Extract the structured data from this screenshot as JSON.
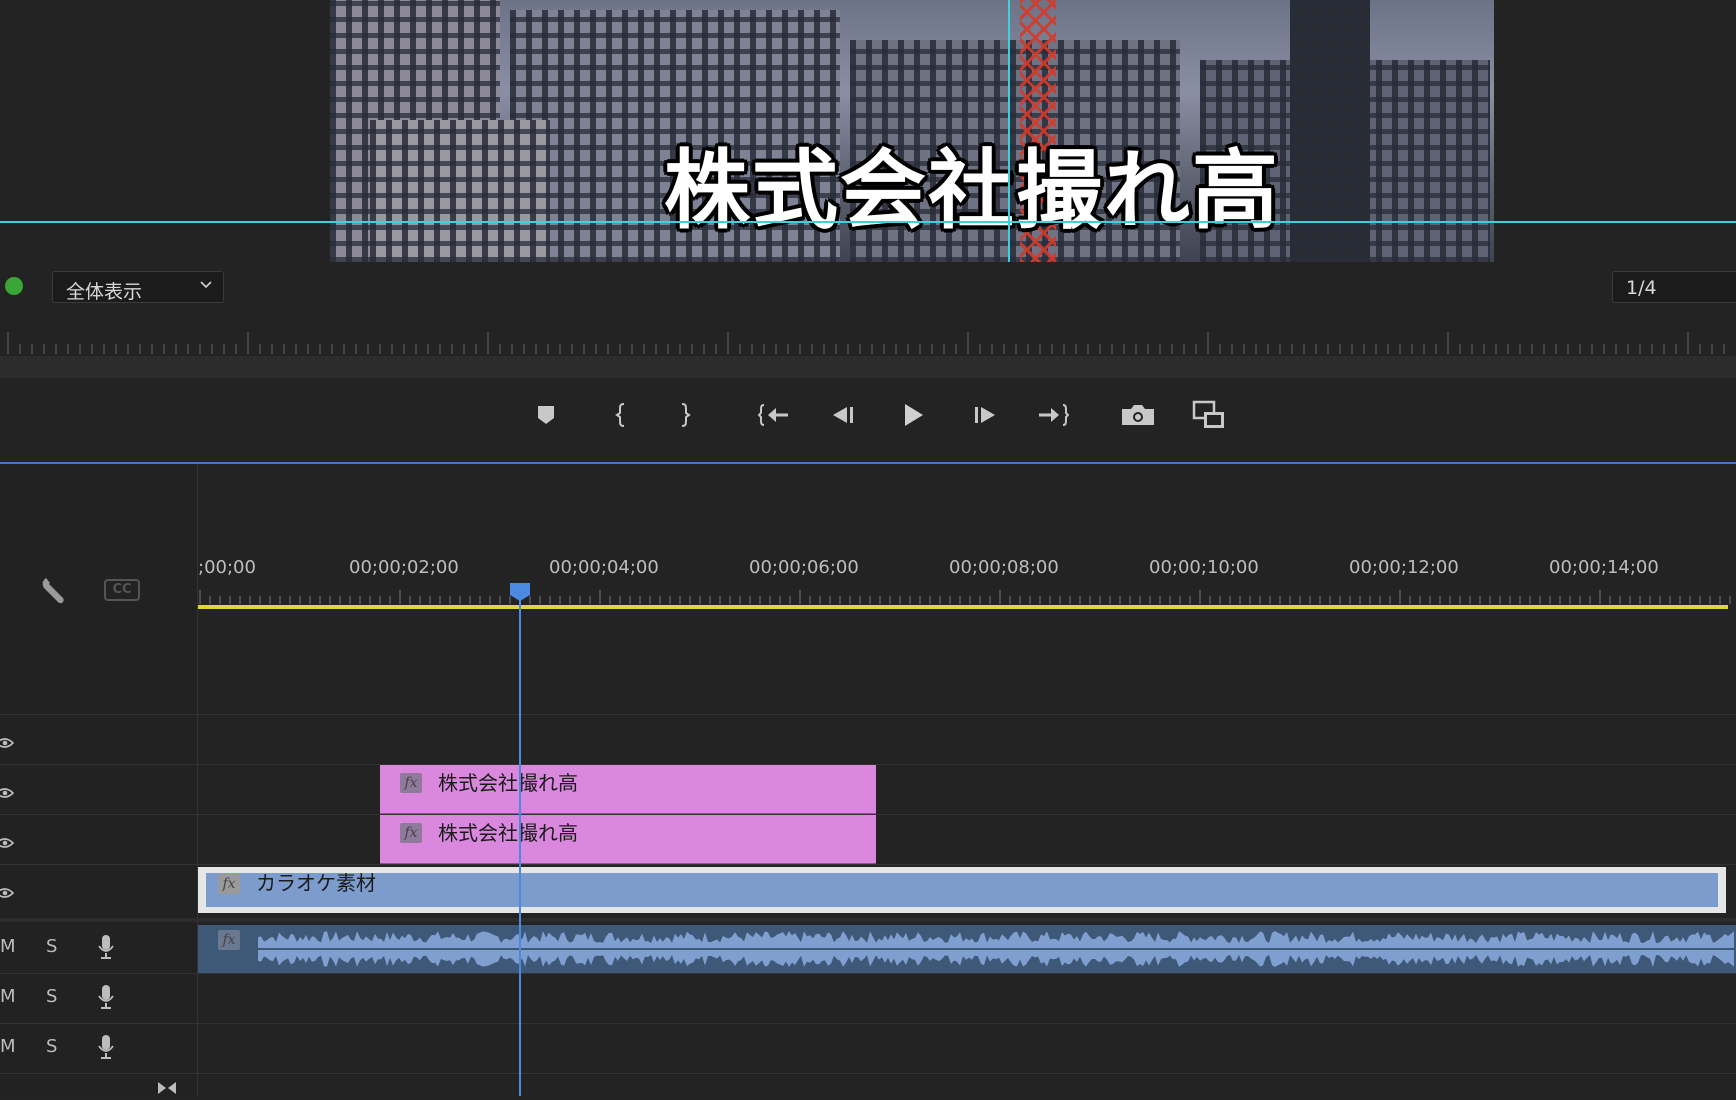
{
  "monitor": {
    "video_caption": "株式会社撮れ高",
    "fit_dropdown": "全体表示",
    "resolution": "1/4"
  },
  "transport": {
    "buttons": [
      {
        "name": "add-marker",
        "icon": "marker-icon"
      },
      {
        "name": "mark-in",
        "icon": "mark-in-icon"
      },
      {
        "name": "mark-out",
        "icon": "mark-out-icon"
      },
      {
        "name": "go-to-in",
        "icon": "go-to-in-icon"
      },
      {
        "name": "step-back",
        "icon": "step-back-icon"
      },
      {
        "name": "play",
        "icon": "play-icon"
      },
      {
        "name": "step-forward",
        "icon": "step-forward-icon"
      },
      {
        "name": "go-to-out",
        "icon": "go-to-out-icon"
      },
      {
        "name": "export-frame",
        "icon": "camera-icon"
      },
      {
        "name": "comparison-view",
        "icon": "compare-icon"
      }
    ]
  },
  "timeline": {
    "timecodes": [
      ";00;00",
      "00;00;02;00",
      "00;00;04;00",
      "00;00;06;00",
      "00;00;08;00",
      "00;00;10;00",
      "00;00;12;00",
      "00;00;14;00"
    ],
    "clips": {
      "title_clip_1": "株式会社撮れ高",
      "title_clip_2": "株式会社撮れ高",
      "video_clip": "カラオケ素材",
      "fx_badge": "fx"
    },
    "audio_tracks": [
      {
        "m": "M",
        "s": "S"
      },
      {
        "m": "M",
        "s": "S"
      },
      {
        "m": "M",
        "s": "S"
      }
    ],
    "cc_label": "CC",
    "colors": {
      "title_clip": "#da88de",
      "video_clip": "#7c9ccd",
      "audio_clip": "#3e5878",
      "work_area": "#e2d53a",
      "playhead": "#4a8ae0",
      "guide": "#3fd0e0"
    }
  }
}
